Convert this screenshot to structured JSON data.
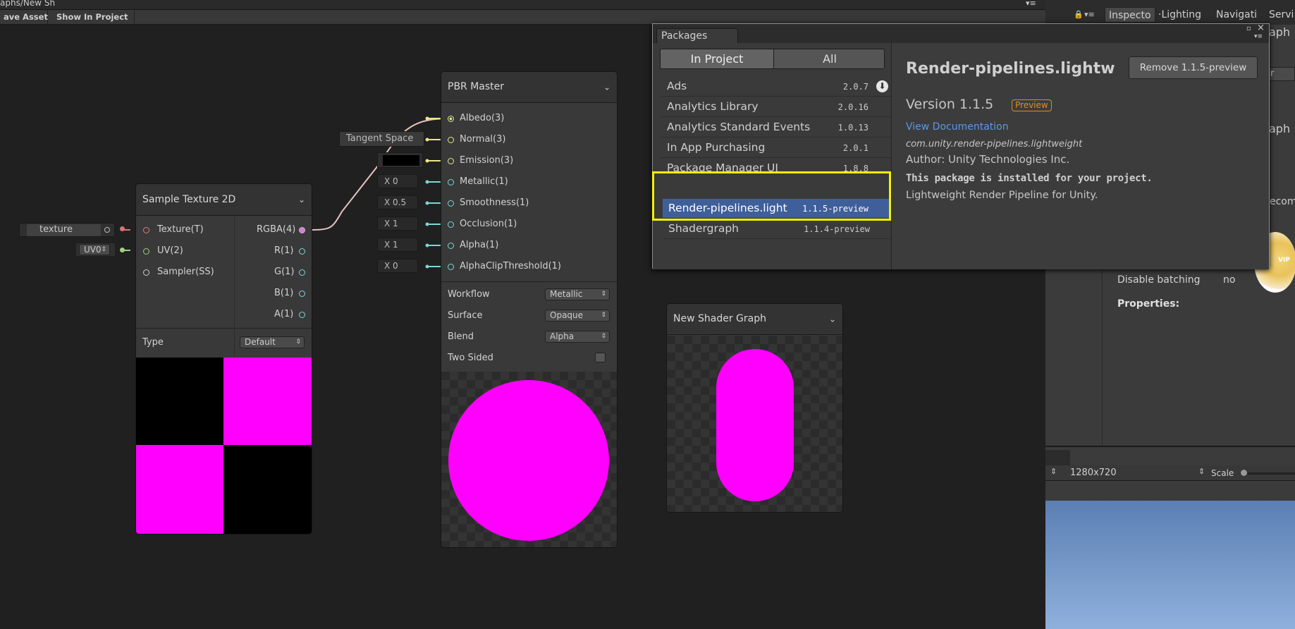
{
  "window": {
    "path_title": "aphs/New Sh"
  },
  "toolbar": {
    "save_asset": "ave Asset",
    "show_in_project": "Show In Project"
  },
  "texture_property": {
    "label": "texture",
    "uv_label": "UV0"
  },
  "sample_texture": {
    "title": "Sample Texture 2D",
    "inputs": [
      "Texture(T)",
      "UV(2)",
      "Sampler(SS)"
    ],
    "outputs": [
      "RGBA(4)",
      "R(1)",
      "G(1)",
      "B(1)",
      "A(1)"
    ],
    "type_label": "Type",
    "type_value": "Default"
  },
  "pbr_master": {
    "title": "PBR Master",
    "tangent_space": "Tangent Space",
    "inputs": [
      "Albedo(3)",
      "Normal(3)",
      "Emission(3)",
      "Metallic(1)",
      "Smoothness(1)",
      "Occlusion(1)",
      "Alpha(1)",
      "AlphaClipThreshold(1)"
    ],
    "values": [
      "X 0",
      "X 0.5",
      "X 1",
      "X 1",
      "X 0"
    ],
    "settings": [
      {
        "label": "Workflow",
        "value": "Metallic"
      },
      {
        "label": "Surface",
        "value": "Opaque"
      },
      {
        "label": "Blend",
        "value": "Alpha"
      }
    ],
    "two_sided": "Two Sided"
  },
  "preview_node": {
    "title": "New Shader Graph"
  },
  "colors": {
    "magenta": "#ff00ff",
    "highlight": "#f2f200",
    "selected": "#3f5f9a",
    "link": "#5a9ae8",
    "preview_badge": "#e28a26"
  },
  "packages": {
    "window_title": "Packages",
    "filter_in_project": "In Project",
    "filter_all": "All",
    "items": [
      {
        "name": "Ads",
        "version": "2.0.7"
      },
      {
        "name": "Analytics Library",
        "version": "2.0.16"
      },
      {
        "name": "Analytics Standard Events",
        "version": "1.0.13"
      },
      {
        "name": "In App Purchasing",
        "version": "2.0.1"
      },
      {
        "name": "Package Manager UI",
        "version": "1.8.8"
      },
      {
        "name": "Render-pipelines.light",
        "version": "1.1.5-preview"
      },
      {
        "name": "Shadergraph",
        "version": "1.1.4-preview"
      }
    ],
    "detail": {
      "title": "Render-pipelines.lightw",
      "remove_button": "Remove 1.1.5-preview",
      "version": "Version 1.1.5",
      "badge": "Preview",
      "doc_link": "View Documentation",
      "package_id": "com.unity.render-pipelines.lightweight",
      "author": "Author: Unity Technologies Inc.",
      "installed_note": "This package is installed for your project.",
      "description": "Lightweight Render Pipeline for Unity."
    }
  },
  "right_panel": {
    "tabs": [
      "Inspecto",
      "Lighting",
      "Navigati",
      "Servi"
    ],
    "fragment_or": "or",
    "fragment_aph1": "aph",
    "fragment_aph2": "aph",
    "fragment_ecomp": "ecomp",
    "disable_batching_label": "Disable batching",
    "disable_batching_value": "no",
    "properties_label": "Properties:",
    "game_resolution": "1280x720",
    "scale_label": "Scale",
    "badge_text": "VIP"
  }
}
